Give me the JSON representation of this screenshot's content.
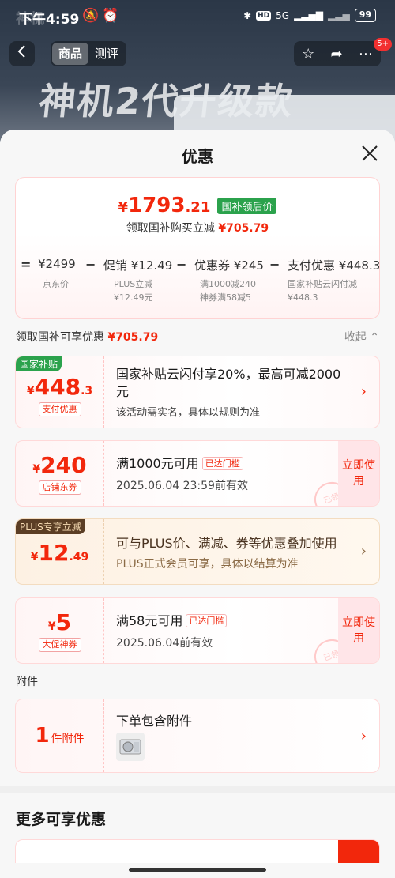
{
  "status_bar": {
    "time": "下午4:59",
    "battery": "99",
    "net": "5G"
  },
  "nav": {
    "tabs": [
      "商品",
      "测评"
    ],
    "badge": "5+"
  },
  "banner": {
    "headline": "神机2代升级款",
    "faint_text": "神机"
  },
  "sheet": {
    "title": "优惠"
  },
  "summary": {
    "price_yen": "¥",
    "price_int": "1793",
    "price_dec": ".21",
    "price_tag": "国补领后价",
    "subtitle": "领取国补购买立减",
    "subtitle_amount": "¥705.79",
    "calc": {
      "eq": "=",
      "jd_price": "¥2499",
      "jd_label": "京东价",
      "op1": "−",
      "promo": "促销 ¥12.49",
      "promo_sub1": "PLUS立减",
      "promo_sub2": "¥12.49元",
      "op2": "−",
      "coupon": "优惠券 ¥245",
      "coupon_sub1": "满1000减240",
      "coupon_sub2": "神券满58减5",
      "op3": "−",
      "pay": "支付优惠 ¥448.3",
      "pay_sub1": "国家补贴云闪付减",
      "pay_sub2": "¥448.3"
    }
  },
  "section": {
    "label": "领取国补可享优惠",
    "amount": "¥705.79",
    "collapse": "收起"
  },
  "cards": [
    {
      "corner": "国家补贴",
      "yen": "¥",
      "num": "448",
      "dec": ".3",
      "tag": "支付优惠",
      "title": "国家补贴云闪付享20%，最高可减2000元",
      "desc": "该活动需实名，具体以规则为准"
    },
    {
      "yen": "¥",
      "num": "240",
      "dec": "",
      "tag": "店铺东券",
      "title": "满1000元可用",
      "threshold": "已达门槛",
      "desc": "2025.06.04 23:59前有效",
      "action": "立即使用",
      "stamp": "已领"
    },
    {
      "corner": "PLUS专享立减",
      "yen": "¥",
      "num": "12",
      "dec": ".49",
      "title": "可与PLUS价、满减、券等优惠叠加使用",
      "desc": "PLUS正式会员可享，具体以结算为准"
    },
    {
      "yen": "¥",
      "num": "5",
      "dec": "",
      "tag": "大促神券",
      "title": "满58元可用",
      "threshold": "已达门槛",
      "desc": "2025.06.04前有效",
      "action": "立即使用",
      "stamp": "已领"
    }
  ],
  "attachment": {
    "label": "附件",
    "count": "1",
    "unit": "件附件",
    "title": "下单包含附件"
  },
  "more": {
    "title": "更多可享优惠"
  },
  "colors": {
    "accent": "#f2270c",
    "green_tag": "#2ba24c",
    "plus_gold": "#8a6a45"
  }
}
